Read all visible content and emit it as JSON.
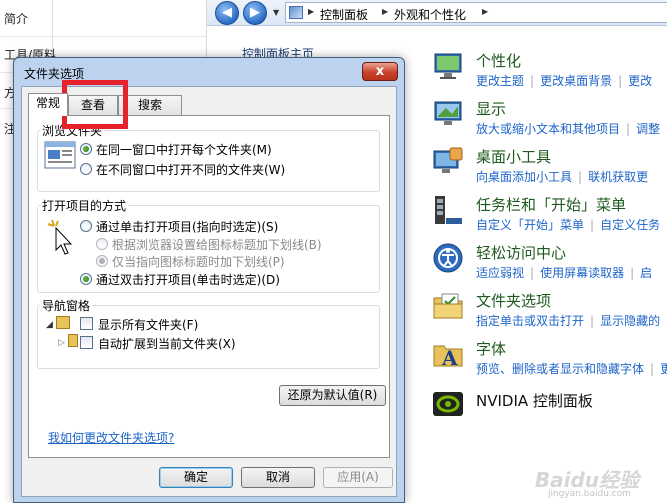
{
  "left_doc": {
    "rows": [
      "简介",
      "工具/原料",
      "方",
      "注"
    ]
  },
  "nav": {
    "breadcrumb": [
      "控制面板",
      "外观和个性化"
    ]
  },
  "cp_left": {
    "home": "控制面板主页"
  },
  "categories": [
    {
      "title": "个性化",
      "links": [
        "更改主题",
        "更改桌面背景",
        "更改"
      ],
      "icon": "personalization-icon"
    },
    {
      "title": "显示",
      "links": [
        "放大或缩小文本和其他项目",
        "调整"
      ],
      "icon": "display-icon"
    },
    {
      "title": "桌面小工具",
      "links": [
        "向桌面添加小工具",
        "联机获取更"
      ],
      "icon": "gadgets-icon"
    },
    {
      "title": "任务栏和「开始」菜单",
      "links": [
        "自定义「开始」菜单",
        "自定义任务"
      ],
      "icon": "taskbar-icon"
    },
    {
      "title": "轻松访问中心",
      "links": [
        "适应弱视",
        "使用屏幕读取器",
        "启"
      ],
      "icon": "ease-of-access-icon"
    },
    {
      "title": "文件夹选项",
      "links": [
        "指定单击或双击打开",
        "显示隐藏的"
      ],
      "icon": "folder-options-icon"
    },
    {
      "title": "字体",
      "links": [
        "预览、删除或者显示和隐藏字体",
        "更"
      ],
      "icon": "fonts-icon"
    },
    {
      "title": "NVIDIA 控制面板",
      "links": [],
      "icon": "nvidia-icon"
    }
  ],
  "dialog": {
    "title": "文件夹选项",
    "close": "x",
    "tabs": [
      "常规",
      "查看",
      "搜索"
    ],
    "browse_group": {
      "label": "浏览文件夹",
      "options": [
        "在同一窗口中打开每个文件夹(M)",
        "在不同窗口中打开不同的文件夹(W)"
      ],
      "selected": 0
    },
    "click_group": {
      "label": "打开项目的方式",
      "single": "通过单击打开项目(指向时选定)(S)",
      "sub1": "根据浏览器设置给图标标题加下划线(B)",
      "sub2": "仅当指向图标标题时加下划线(P)",
      "double": "通过双击打开项目(单击时选定)(D)"
    },
    "nav_group": {
      "label": "导航窗格",
      "show_all": "显示所有文件夹(F)",
      "auto_expand": "自动扩展到当前文件夹(X)"
    },
    "restore_button": "还原为默认值(R)",
    "help_link": "我如何更改文件夹选项?",
    "ok": "确定",
    "cancel": "取消",
    "apply": "应用(A)"
  },
  "watermark": {
    "text": "Baidu经验",
    "sub": "jingyan.baidu.com"
  }
}
